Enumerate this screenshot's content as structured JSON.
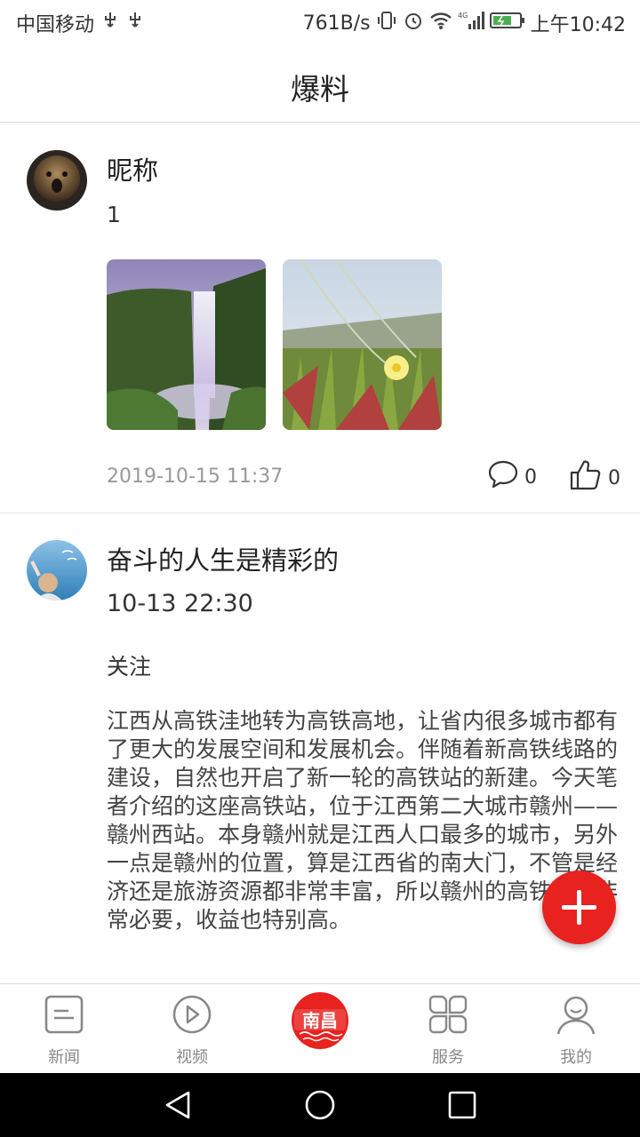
{
  "status_bar": {
    "carrier": "中国移动",
    "network_speed": "761B/s",
    "network_type": "4G",
    "time": "上午10:42"
  },
  "header": {
    "title": "爆料"
  },
  "posts": [
    {
      "nickname": "昵称",
      "content": "1",
      "images": [
        "waterfall-photo",
        "flower-photo"
      ],
      "timestamp": "2019-10-15 11:37",
      "comment_count": "0",
      "like_count": "0"
    },
    {
      "nickname": "奋斗的人生是精彩的",
      "time": "10-13 22:30",
      "follow_label": "关注",
      "body": "江西从高铁洼地转为高铁高地，让省内很多城市都有了更大的发展空间和发展机会。伴随着新高铁线路的建设，自然也开启了新一轮的高铁站的新建。今天笔者介绍的这座高铁站，位于江西第二大城市赣州——赣州西站。本身赣州就是江西人口最多的城市，另外一点是赣州的位置，算是江西省的南大门，不管是经济还是旅游资源都非常丰富，所以赣州的高铁建设非常必要，收益也特别高。"
    }
  ],
  "tabs": [
    {
      "label": "新闻",
      "icon": "news-icon"
    },
    {
      "label": "视频",
      "icon": "video-play-icon"
    },
    {
      "label": "南昌",
      "icon": "nanchang-logo"
    },
    {
      "label": "服务",
      "icon": "services-grid-icon"
    },
    {
      "label": "我的",
      "icon": "profile-icon"
    }
  ],
  "colors": {
    "accent": "#e8221f",
    "text_muted": "#999999"
  }
}
